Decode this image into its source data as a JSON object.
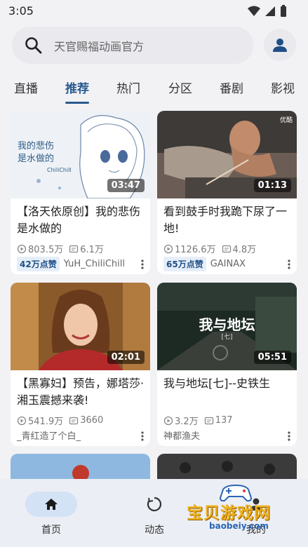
{
  "status": {
    "time": "3:05"
  },
  "search": {
    "placeholder": "天官赐福动画官方"
  },
  "tabs": [
    "直播",
    "推荐",
    "热门",
    "分区",
    "番剧",
    "影视"
  ],
  "videos": [
    {
      "title": "【洛天依原创】我的悲伤是水做的",
      "duration": "03:47",
      "views": "803.5万",
      "danmaku": "6.1万",
      "likes_badge": "42万点赞",
      "uploader": "YuH_ChiliChill",
      "thumb_text": "我的悲伤\n是水做的",
      "thumb_sub": "ChiliChill"
    },
    {
      "title": "看到鼓手时我跪下尿了一地!",
      "duration": "01:13",
      "views": "1126.6万",
      "danmaku": "4.8万",
      "likes_badge": "65万点赞",
      "uploader": "GAINAX",
      "thumb_text": "优酷"
    },
    {
      "title": "【黑寡妇】预告，娜塔莎·湘玉震撼来袭!",
      "duration": "02:01",
      "views": "541.9万",
      "danmaku": "3660",
      "likes_badge": "",
      "uploader": "_青红造了个白_"
    },
    {
      "title": "我与地坛[七]--史铁生",
      "duration": "05:51",
      "views": "3.2万",
      "danmaku": "137",
      "likes_badge": "",
      "uploader": "神都渔夫",
      "thumb_text": "我与地坛",
      "thumb_sub": "[七]"
    }
  ],
  "nav": {
    "home": "首页",
    "dynamic": "动态",
    "mine": "我的"
  },
  "watermark": {
    "text": "宝贝游戏网",
    "url": "baobeiy.com"
  },
  "colors": {
    "accent": "#2a5b8f",
    "badge_bg": "#e6eef8",
    "nav_active": "#d3e2f5"
  }
}
